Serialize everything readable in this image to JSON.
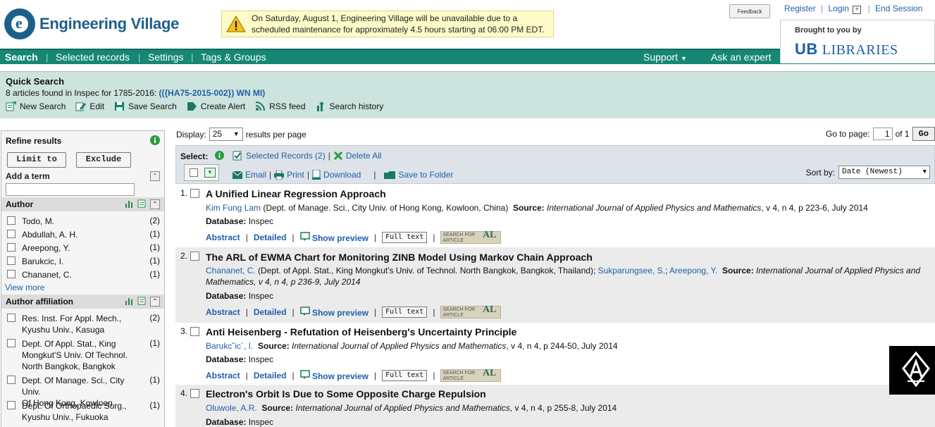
{
  "brand": {
    "name": "Engineering Village",
    "logo_letter": "e"
  },
  "alert": {
    "message_line1": "On Saturday, August 1, Engineering Village will be unavailable due to a",
    "message_line2": "scheduled maintenance for approximately 4.5 hours starting at 06:00 PM EDT."
  },
  "feedback": "Feedback",
  "toplinks": {
    "register": "Register",
    "login": "Login",
    "end_session": "End Session"
  },
  "brought": {
    "label": "Brought to you by",
    "ub": "UB",
    "libraries": "LIBRARIES"
  },
  "nav": {
    "search": "Search",
    "selected": "Selected records",
    "settings": "Settings",
    "tags": "Tags & Groups",
    "support": "Support",
    "expert": "Ask an expert"
  },
  "quick": {
    "title": "Quick Search",
    "found_text": "8 articles found in Inspec for 1785-2016:",
    "query": "(({HA75-2015-002}) WN MI)",
    "tools": [
      "New Search",
      "Edit",
      "Save Search",
      "Create Alert",
      "RSS feed",
      "Search history"
    ]
  },
  "refine": {
    "title": "Refine results",
    "limit": "Limit to",
    "exclude": "Exclude",
    "add_term": "Add a term",
    "author_title": "Author",
    "authors": [
      {
        "name": "Todo, M.",
        "count": "(2)"
      },
      {
        "name": "Abdullah, A. H.",
        "count": "(1)"
      },
      {
        "name": "Areepong, Y.",
        "count": "(1)"
      },
      {
        "name": "Barukcic, I.",
        "count": "(1)"
      },
      {
        "name": "Chananet, C.",
        "count": "(1)"
      }
    ],
    "view_more": "View more",
    "affil_title": "Author affiliation",
    "affils": [
      {
        "l1": "Res. Inst. For Appl. Mech.,",
        "l2": "Kyushu Univ., Kasuga",
        "l3": "",
        "count": "(2)"
      },
      {
        "l1": "Dept. Of Appl. Stat., King",
        "l2": "Mongkut'S Univ. Of Technol.",
        "l3": "North Bangkok, Bangkok",
        "count": "(1)"
      },
      {
        "l1": "Dept. Of Manage. Sci., City Univ.",
        "l2": "Of Hong Kong, Kowloon",
        "l3": "",
        "count": "(1)"
      },
      {
        "l1": "Dept. Of Orthopaedic Surg.,",
        "l2": "Kyushu Univ., Fukuoka",
        "l3": "",
        "count": "(1)"
      }
    ]
  },
  "display": {
    "label": "Display:",
    "value": "25",
    "suffix": "results per page"
  },
  "goto": {
    "label": "Go to page:",
    "page": "1",
    "of": "of 1",
    "go": "Go"
  },
  "selbar": {
    "select": "Select:",
    "selected_records": "Selected Records (2)",
    "delete_all": "Delete All",
    "email": "Email",
    "print": "Print",
    "download": "Download",
    "save_folder": "Save to Folder",
    "sort_label": "Sort by:",
    "sort_value": "Date (Newest)"
  },
  "actions": {
    "abstract": "Abstract",
    "detailed": "Detailed",
    "preview": "Show preview",
    "fulltext": "Full text",
    "sfa_top": "SEARCH FOR",
    "sfa_bottom": "ARTICLE",
    "sfa_logo": "AL"
  },
  "db_label": "Database:",
  "source_label": "Source:",
  "results": [
    {
      "num": "1.",
      "title": "A Unified Linear Regression Approach",
      "authors": "Kim Fung Lam",
      "affil": " (Dept. of Manage. Sci., City Univ. of Hong Kong, Kowloon, China)",
      "source": "International Journal of Applied Physics and Mathematics",
      "details": ", v 4, n 4, p 223-6, July 2014",
      "db": "Inspec"
    },
    {
      "num": "2.",
      "title": "The ARL of EWMA Chart for Monitoring ZINB Model Using Markov Chain Approach",
      "authors": "Chananet, C.",
      "affil": " (Dept. of Appl. Stat., King Mongkut's Univ. of Technol. North Bangkok, Bangkok, Thailand);",
      "author2": "Sukparungsee, S.",
      "author3": "Areepong, Y.",
      "source": "International Journal of Applied Physics and Mathematics",
      "details": ", v 4, n 4, p 236-9, July 2014",
      "db": "Inspec"
    },
    {
      "num": "3.",
      "title": "Anti Heisenberg - Refutation of Heisenberg's Uncertainty Principle",
      "authors": "Barukc˘ic´, I.",
      "affil": "",
      "source": "International Journal of Applied Physics and Mathematics",
      "details": ", v 4, n 4, p 244-50, July 2014",
      "db": "Inspec"
    },
    {
      "num": "4.",
      "title": "Electron's Orbit Is Due to Some Opposite Charge Repulsion",
      "authors": "Oluwole, A.R.",
      "affil": "",
      "source": "International Journal of Applied Physics and Mathematics",
      "details": ", v 4, n 4, p 255-8, July 2014",
      "db": "Inspec"
    }
  ]
}
